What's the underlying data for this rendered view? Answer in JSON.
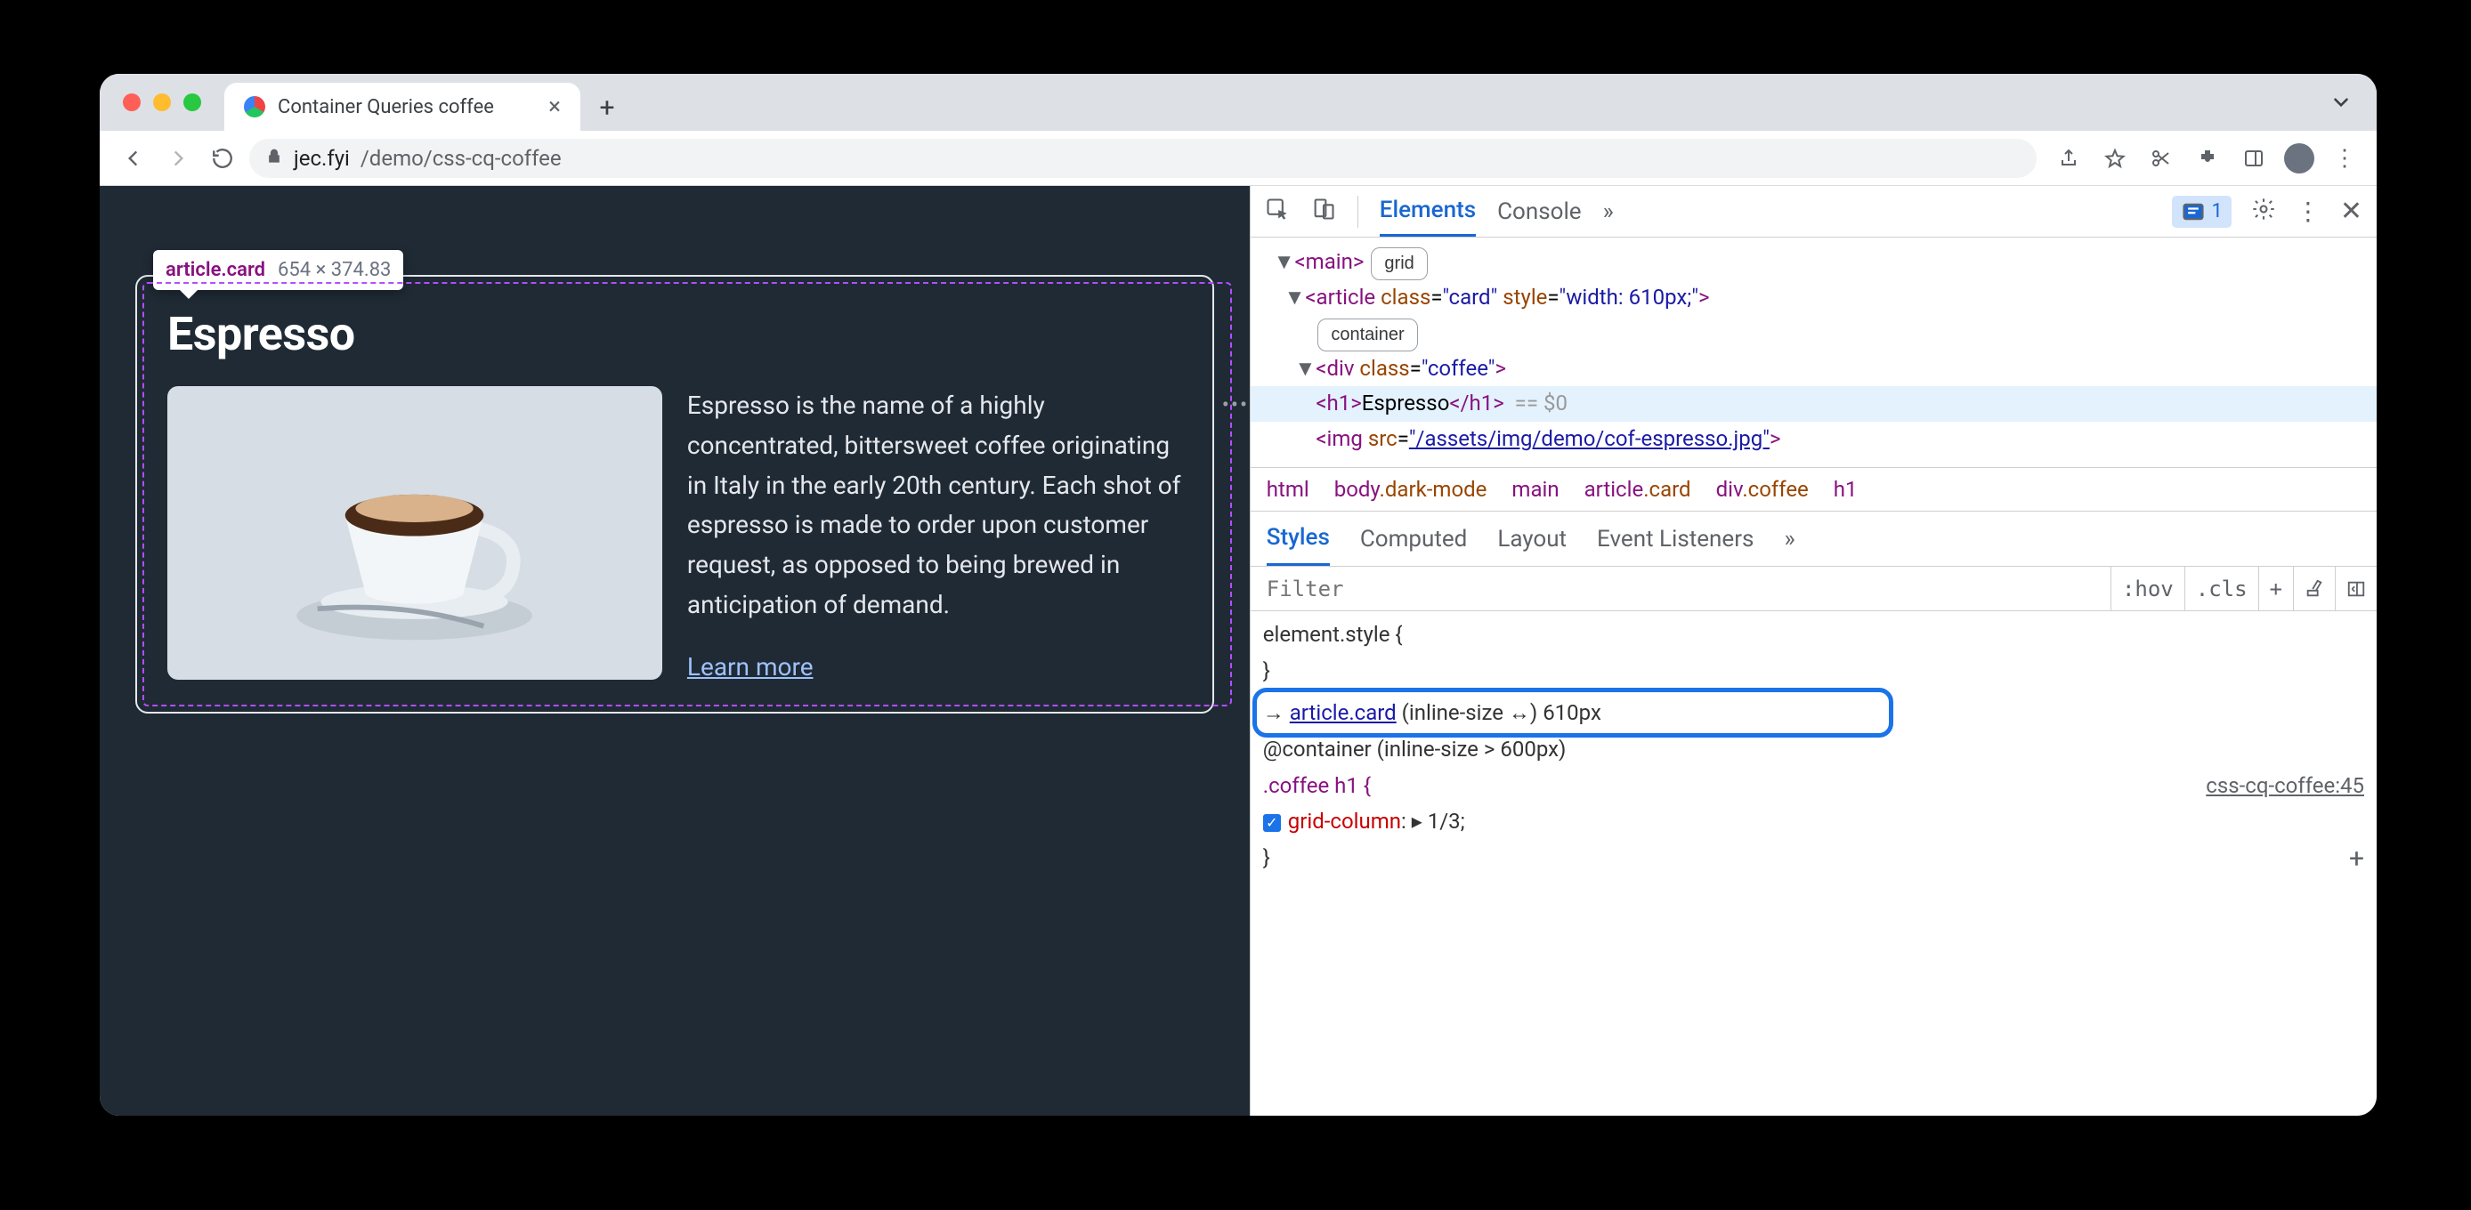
{
  "tab": {
    "title": "Container Queries coffee"
  },
  "url": {
    "host": "jec.fyi",
    "path": "/demo/css-cq-coffee"
  },
  "inspect_tip": {
    "selector": "article.card",
    "dims": "654 × 374.83"
  },
  "card": {
    "heading": "Espresso",
    "body": "Espresso is the name of a highly concentrated, bittersweet coffee originating in Italy in the early 20th century. Each shot of espresso is made to order upon customer request, as opposed to being brewed in anticipation of demand.",
    "link": "Learn more"
  },
  "devtools": {
    "tabs": {
      "elements": "Elements",
      "console": "Console"
    },
    "issue_count": "1",
    "dom": {
      "main": "<main>",
      "main_badge": "grid",
      "article_open": "<article",
      "article_cls_attr": "class",
      "article_cls_val": "\"card\"",
      "article_style_attr": "style",
      "article_style_val": "\"width: 610px;\"",
      "article_badge": "container",
      "div_open": "<div",
      "div_cls_attr": "class",
      "div_cls_val": "\"coffee\"",
      "h1_open": "<h1>",
      "h1_text": "Espresso",
      "h1_close": "</h1>",
      "h1_suffix": "== $0",
      "img_open": "<img",
      "img_attr": "src",
      "img_val": "\"/assets/img/demo/cof-espresso.jpg\""
    },
    "crumbs": {
      "html": "html",
      "body": "body.dark-mode",
      "main": "main",
      "article": "article.card",
      "div": "div.coffee",
      "h1": "h1"
    },
    "style_tabs": {
      "styles": "Styles",
      "computed": "Computed",
      "layout": "Layout",
      "listeners": "Event Listeners"
    },
    "filter": {
      "placeholder": "Filter",
      "hov": ":hov",
      "cls": ".cls"
    },
    "rules": {
      "el_style": "element.style {",
      "close": "}",
      "cq_selector": "article.card",
      "cq_meta": " (inline-size ↔) 610px",
      "at": "@container (inline-size > 600px)",
      "sel2": ".coffee h1 {",
      "file": "css-cq-coffee:45",
      "prop": "grid-column",
      "val": "1/3;"
    }
  }
}
